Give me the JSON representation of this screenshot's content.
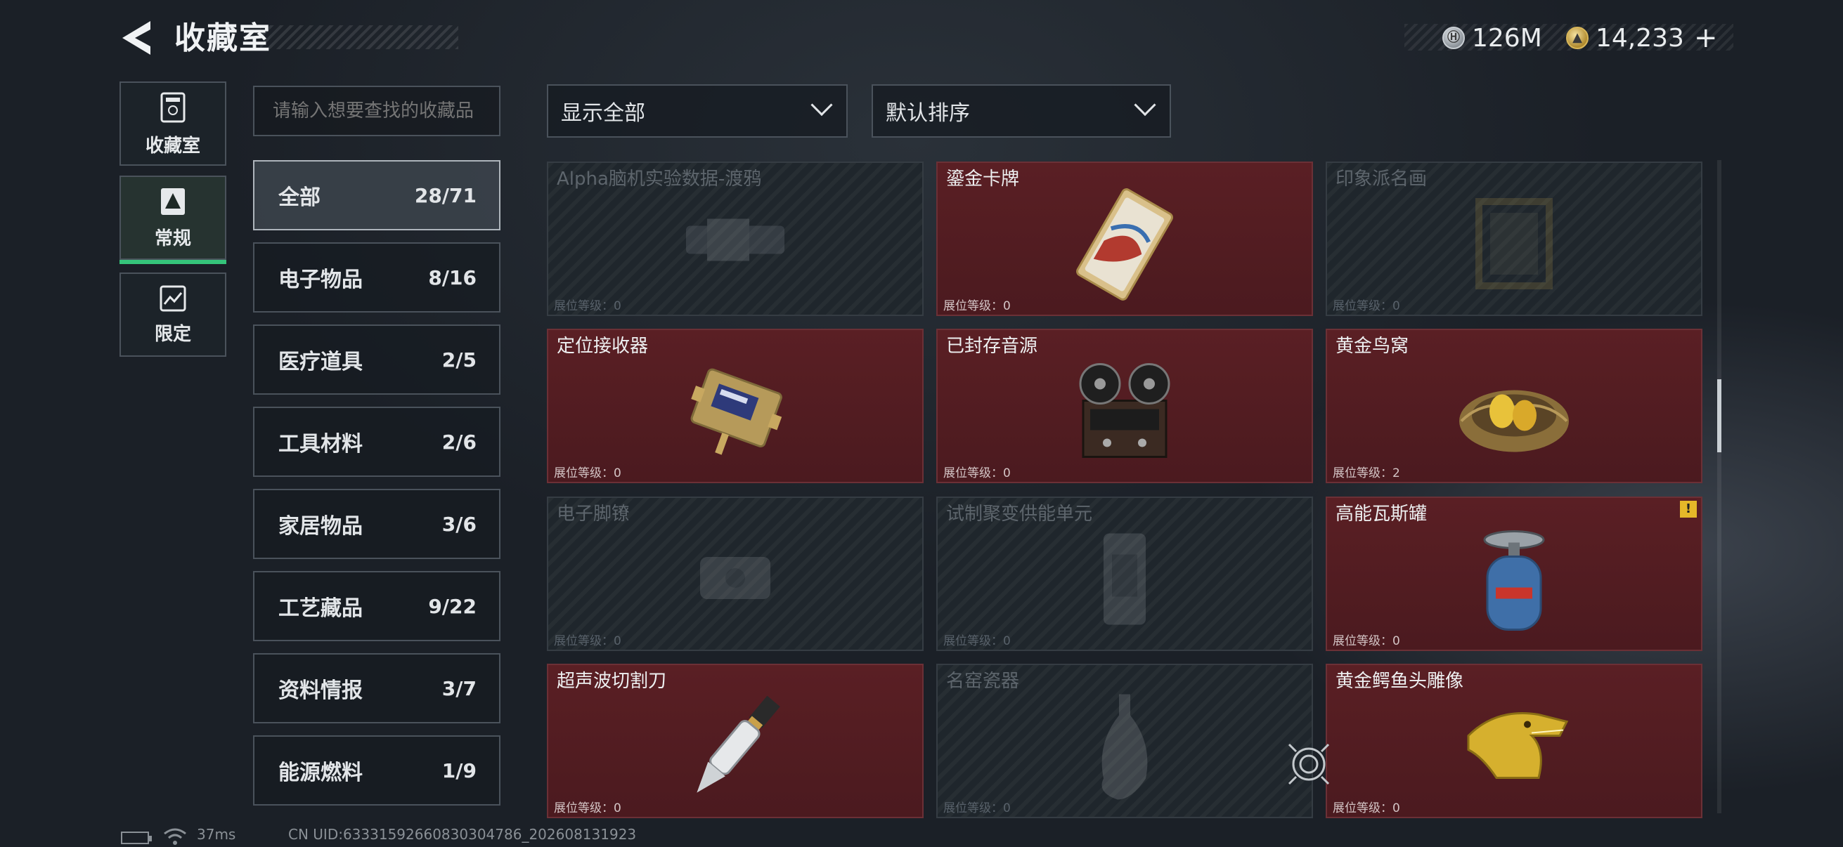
{
  "header": {
    "title": "收藏室",
    "currencies": [
      {
        "icon": "silver-coin-icon",
        "value": "126M"
      },
      {
        "icon": "gold-coin-icon",
        "value": "14,233"
      }
    ],
    "add_label": "+"
  },
  "nav": [
    {
      "label": "收藏室",
      "icon": "collection-room-icon",
      "active": false
    },
    {
      "label": "常规",
      "icon": "regular-icon",
      "active": true
    },
    {
      "label": "限定",
      "icon": "limited-icon",
      "active": false
    }
  ],
  "search": {
    "placeholder": "请输入想要查找的收藏品"
  },
  "filters": {
    "display": "显示全部",
    "sort": "默认排序"
  },
  "categories": [
    {
      "name": "全部",
      "count": "28/71",
      "active": true
    },
    {
      "name": "电子物品",
      "count": "8/16"
    },
    {
      "name": "医疗道具",
      "count": "2/5"
    },
    {
      "name": "工具材料",
      "count": "2/6"
    },
    {
      "name": "家居物品",
      "count": "3/6"
    },
    {
      "name": "工艺藏品",
      "count": "9/22"
    },
    {
      "name": "资料情报",
      "count": "3/7"
    },
    {
      "name": "能源燃料",
      "count": "1/9"
    }
  ],
  "items": [
    {
      "name": "Alpha脑机实验数据-渡鸦",
      "level": "展位等级：0",
      "owned": false
    },
    {
      "name": "鎏金卡牌",
      "level": "展位等级：0",
      "owned": true
    },
    {
      "name": "印象派名画",
      "level": "展位等级：0",
      "owned": false
    },
    {
      "name": "定位接收器",
      "level": "展位等级：0",
      "owned": true
    },
    {
      "name": "已封存音源",
      "level": "展位等级：0",
      "owned": true
    },
    {
      "name": "黄金鸟窝",
      "level": "展位等级：2",
      "owned": true
    },
    {
      "name": "电子脚镣",
      "level": "展位等级：0",
      "owned": false
    },
    {
      "name": "试制聚变供能单元",
      "level": "展位等级：0",
      "owned": false
    },
    {
      "name": "高能瓦斯罐",
      "level": "展位等级：0",
      "owned": true,
      "badge": "!"
    },
    {
      "name": "超声波切割刀",
      "level": "展位等级：0",
      "owned": true
    },
    {
      "name": "名窑瓷器",
      "level": "展位等级：0",
      "owned": false
    },
    {
      "name": "黄金鳄鱼头雕像",
      "level": "展位等级：0",
      "owned": true
    }
  ],
  "footer": {
    "ping": "37ms",
    "uid": "CN UID:6333159266083030478​6_202608131923"
  }
}
